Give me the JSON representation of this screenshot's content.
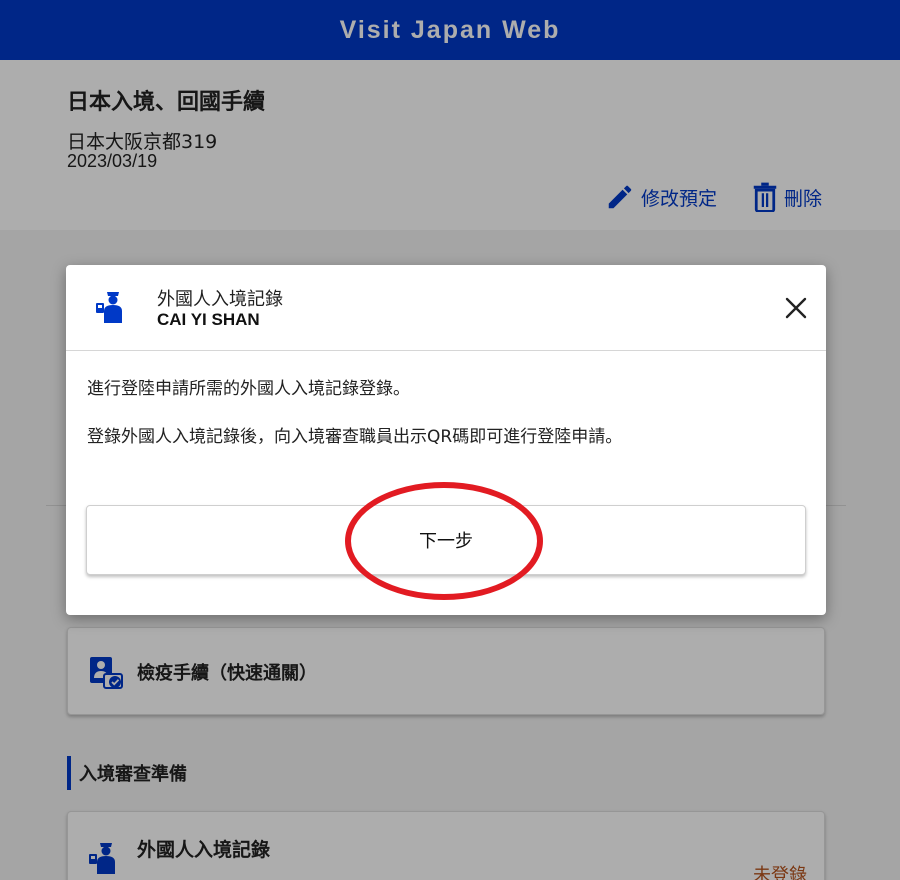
{
  "header": {
    "title": "Visit Japan Web"
  },
  "trip": {
    "title": "日本入境、回國手續",
    "address": "日本大阪京都319",
    "date": "2023/03/19",
    "edit_label": "修改預定",
    "delete_label": "刪除"
  },
  "cards": {
    "quarantine_label": "檢疫手續（快速通關）",
    "section_title": "入境審查準備",
    "record_label": "外國人入境記錄",
    "record_status": "未登錄"
  },
  "modal": {
    "title": "外國人入境記錄",
    "subtitle": "CAI YI SHAN",
    "text1": "進行登陸申請所需的外國人入境記錄登錄。",
    "text2": "登錄外國人入境記錄後，向入境審查職員出示QR碼即可進行登陸申請。",
    "next_label": "下一步"
  },
  "colors": {
    "brand": "#0039c7",
    "status_unregistered": "#b5531c",
    "annotation": "#e21b22"
  },
  "icons": {
    "edit": "pencil-icon",
    "delete": "trash-icon",
    "immigration": "immigration-officer-icon",
    "quarantine": "quarantine-icon",
    "close": "close-icon"
  }
}
